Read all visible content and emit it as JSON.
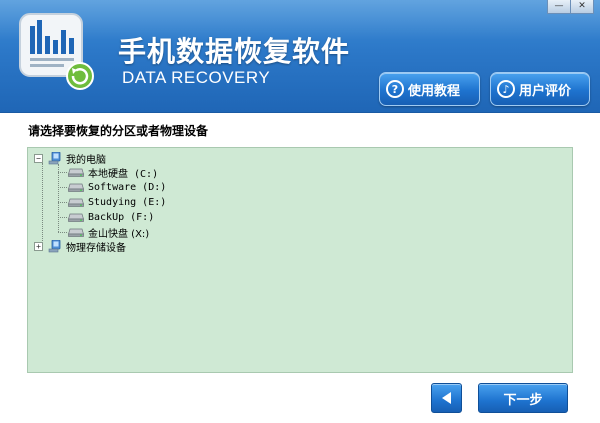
{
  "window": {
    "controls": {
      "minimize": "—",
      "close": "✕"
    }
  },
  "header": {
    "title_cn": "手机数据恢复软件",
    "title_en": "DATA RECOVERY",
    "tutorial_label": "使用教程",
    "rating_label": "用户评价",
    "logo_icon": "chart-recovery-icon",
    "colors": {
      "header_bg": "#2c78c8",
      "button_bg": "#1e73cf"
    }
  },
  "main": {
    "prompt": "请选择要恢复的分区或者物理设备",
    "tree": {
      "root": {
        "label": "我的电脑",
        "expanded": true,
        "icon": "computer-icon"
      },
      "drives": [
        {
          "label": "本地硬盘 (C:)",
          "icon": "hard-drive-icon"
        },
        {
          "label": "Software (D:)",
          "icon": "hard-drive-icon"
        },
        {
          "label": "Studying (E:)",
          "icon": "hard-drive-icon"
        },
        {
          "label": "BackUp (F:)",
          "icon": "hard-drive-icon"
        },
        {
          "label": "金山快盘 (X:)",
          "icon": "hard-drive-icon"
        }
      ],
      "physical": {
        "label": "物理存储设备",
        "expanded": false,
        "icon": "computer-icon"
      }
    },
    "tree_bg": "#cfe9d4"
  },
  "footer": {
    "back_icon": "triangle-left-icon",
    "next_label": "下一步"
  }
}
